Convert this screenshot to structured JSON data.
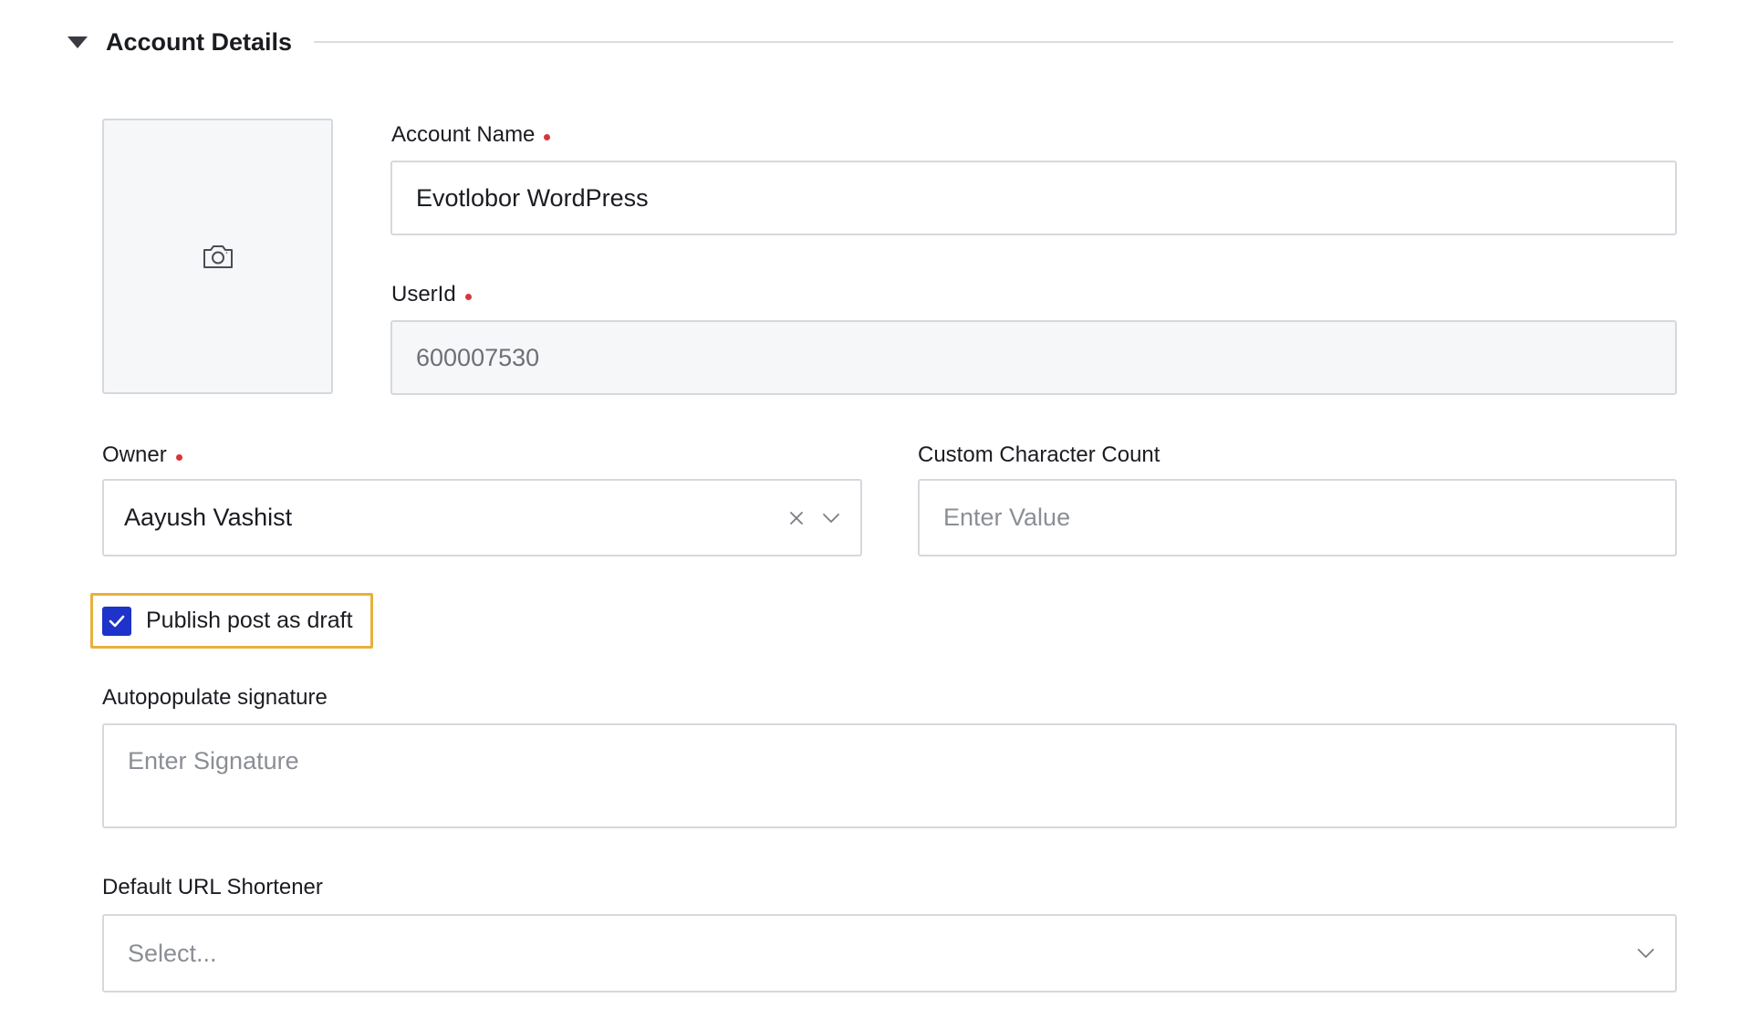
{
  "section": {
    "title": "Account Details",
    "toggle_icon": "caret-down-icon"
  },
  "avatar": {
    "icon": "camera-icon"
  },
  "account_name": {
    "label": "Account Name",
    "value": "Evotlobor WordPress",
    "required": true
  },
  "user_id": {
    "label": "UserId",
    "value": "600007530",
    "required": true,
    "disabled": true
  },
  "owner": {
    "label": "Owner",
    "value": "Aayush Vashist",
    "required": true,
    "clear_icon": "close-icon",
    "dropdown_icon": "chevron-down-icon"
  },
  "custom_char_count": {
    "label": "Custom Character Count",
    "placeholder": "Enter Value"
  },
  "publish_draft": {
    "label": "Publish post as draft",
    "checked": true
  },
  "signature": {
    "label": "Autopopulate signature",
    "placeholder": "Enter Signature"
  },
  "url_shortener": {
    "label": "Default URL Shortener",
    "placeholder": "Select...",
    "dropdown_icon": "chevron-down-icon"
  },
  "colors": {
    "checkbox": "#1d33c9",
    "focus_ring": "#e8b03c",
    "required_dot": "#d9353b",
    "border": "#d7d8dd"
  }
}
